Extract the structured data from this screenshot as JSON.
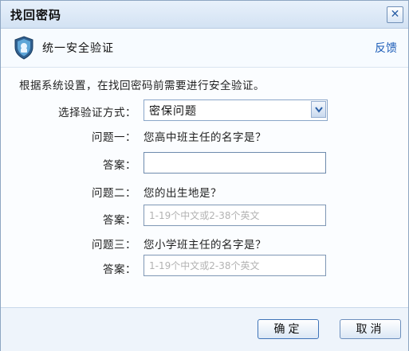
{
  "dialog": {
    "title": "找回密码",
    "close_glyph": "✕"
  },
  "security_bar": {
    "title": "统一安全验证",
    "feedback_label": "反馈",
    "icon": "shield-icon"
  },
  "form": {
    "intro": "根据系统设置，在找回密码前需要进行安全验证。",
    "method_label": "选择验证方式：",
    "method_value": "密保问题",
    "questions": [
      {
        "label": "问题一：",
        "text": "您高中班主任的名字是？",
        "answer_label": "答案：",
        "answer_value": "",
        "placeholder": ""
      },
      {
        "label": "问题二：",
        "text": "您的出生地是？",
        "answer_label": "答案：",
        "answer_value": "",
        "placeholder": "1-19个中文或2-38个英文"
      },
      {
        "label": "问题三：",
        "text": "您小学班主任的名字是？",
        "answer_label": "答案：",
        "answer_value": "",
        "placeholder": "1-19个中文或2-38个英文"
      }
    ]
  },
  "footer": {
    "confirm_label": "确定",
    "cancel_label": "取消"
  },
  "colors": {
    "accent": "#1d5db8",
    "border": "#8ea6c2"
  }
}
